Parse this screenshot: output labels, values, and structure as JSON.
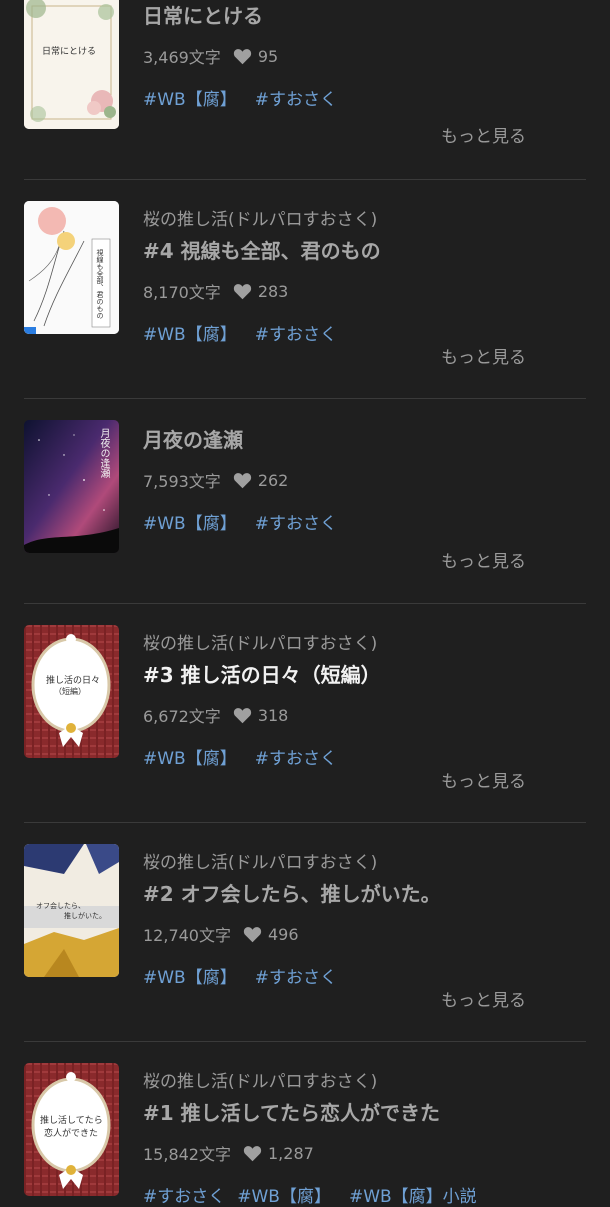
{
  "items": [
    {
      "series": "",
      "title": "日常にとける",
      "chars": "3,469文字",
      "likes": "95",
      "tags": [
        "#WB【腐】",
        "#すおさく"
      ],
      "more": "もっと見る",
      "cover_text": "日常にとける"
    },
    {
      "series": "桜の推し活(ドルパロすおさく)",
      "title": "#4 視線も全部、君のもの",
      "chars": "8,170文字",
      "likes": "283",
      "tags": [
        "#WB【腐】",
        "#すおさく"
      ],
      "more": "もっと見る",
      "cover_text": "視線も全部、君のもの"
    },
    {
      "series": "",
      "title": "月夜の逢瀬",
      "chars": "7,593文字",
      "likes": "262",
      "tags": [
        "#WB【腐】",
        "#すおさく"
      ],
      "more": "もっと見る",
      "cover_text": "月夜の逢瀬"
    },
    {
      "series": "桜の推し活(ドルパロすおさく)",
      "title": "#3 推し活の日々（短編）",
      "chars": "6,672文字",
      "likes": "318",
      "tags": [
        "#WB【腐】",
        "#すおさく"
      ],
      "more": "もっと見る",
      "cover_text": "推し活の日々",
      "cover_sub": "（短編）"
    },
    {
      "series": "桜の推し活(ドルパロすおさく)",
      "title": "#2 オフ会したら、推しがいた。",
      "chars": "12,740文字",
      "likes": "496",
      "tags": [
        "#WB【腐】",
        "#すおさく"
      ],
      "more": "もっと見る",
      "cover_text": "オフ会したら、",
      "cover_sub": "推しがいた。"
    },
    {
      "series": "桜の推し活(ドルパロすおさく)",
      "title": "#1 推し活してたら恋人ができた",
      "chars": "15,842文字",
      "likes": "1,287",
      "tags": [
        "#すおさく",
        "#WB【腐】",
        "#WB【腐】小説"
      ],
      "more": "もっと見る",
      "cover_text": "推し活してたら",
      "cover_sub": "恋人ができた"
    }
  ],
  "colors": {
    "background": "#1f1f1f",
    "tag": "#6fa0d4",
    "muted": "#9a9a9a"
  }
}
